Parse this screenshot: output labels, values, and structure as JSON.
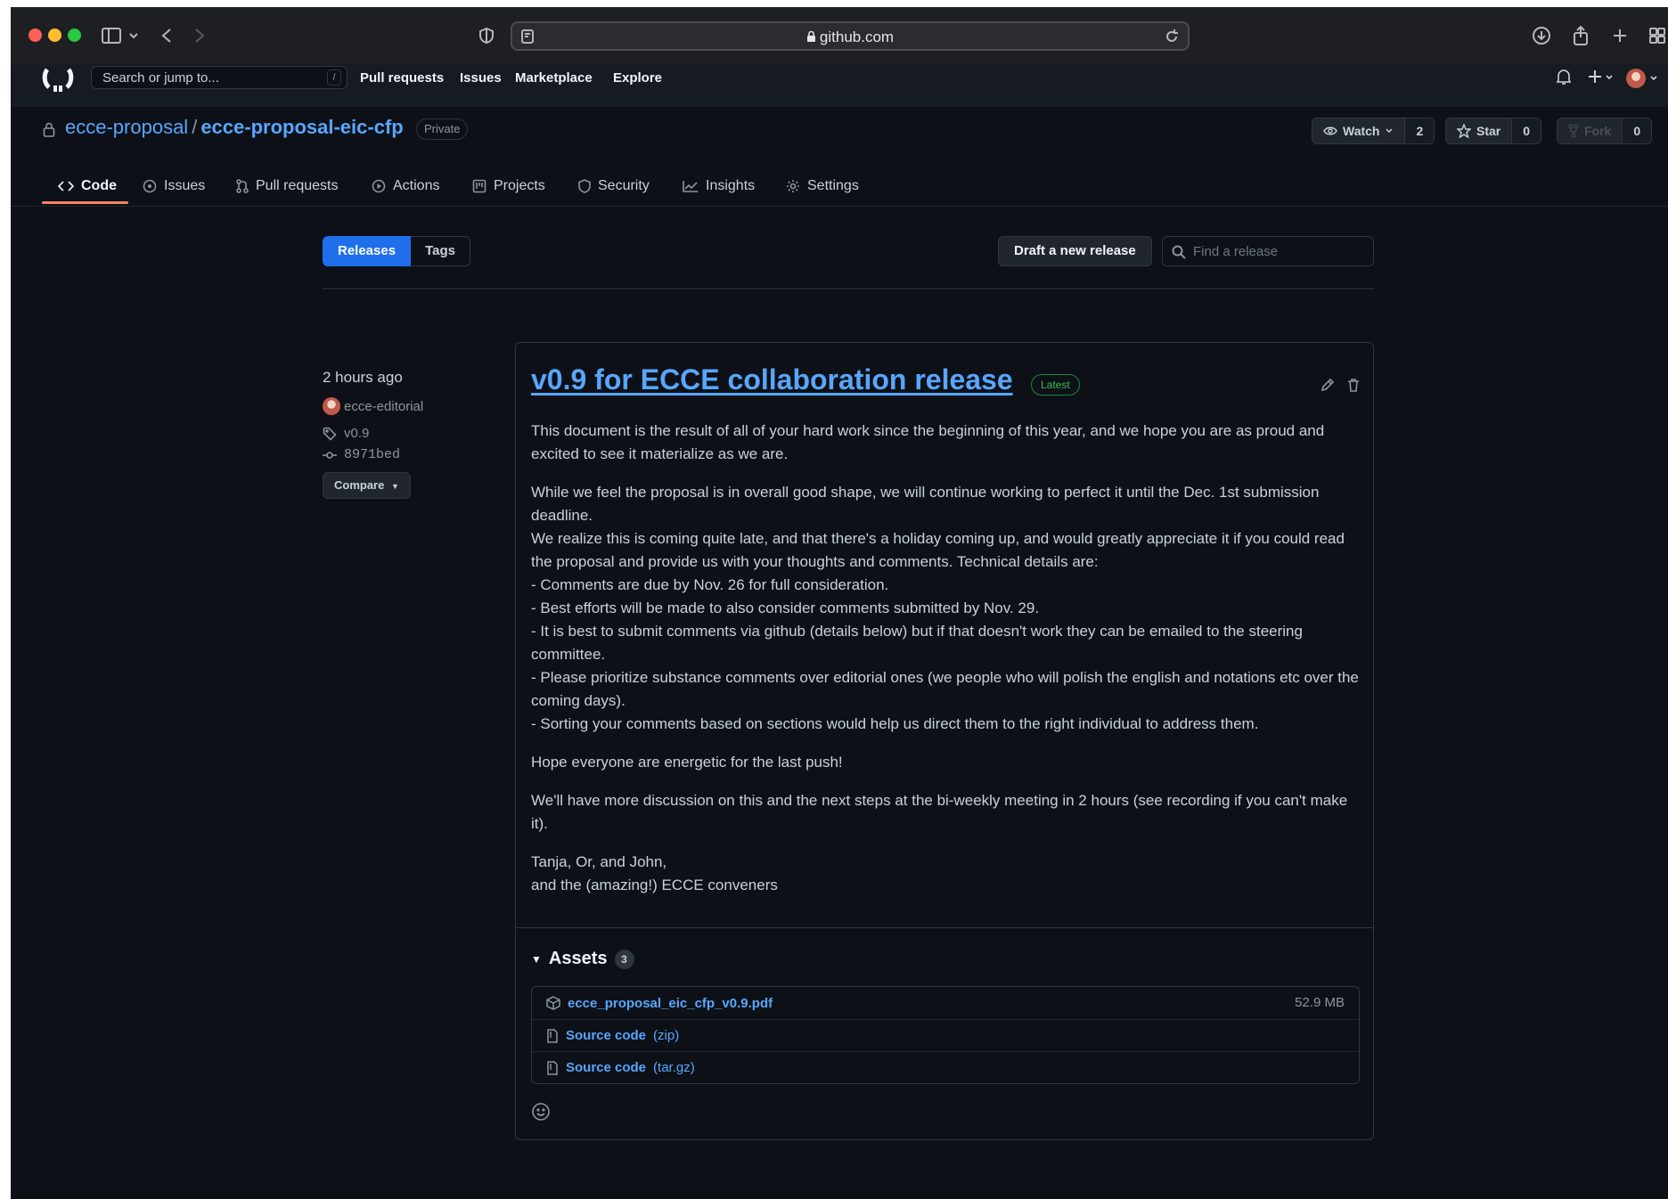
{
  "browser": {
    "url": "github.com",
    "colors": {
      "close": "#ff5f57",
      "minimize": "#febc2e",
      "maximize": "#28c840"
    }
  },
  "header": {
    "search_placeholder": "Search or jump to...",
    "search_shortcut": "/",
    "nav": [
      "Pull requests",
      "Issues",
      "Marketplace",
      "Explore"
    ]
  },
  "repo": {
    "owner": "ecce-proposal",
    "separator": "/",
    "name": "ecce-proposal-eic-cfp",
    "visibility": "Private",
    "watch_label": "Watch",
    "watch_count": "2",
    "star_label": "Star",
    "star_count": "0",
    "fork_label": "Fork",
    "fork_count": "0"
  },
  "tabs": {
    "code": "Code",
    "issues": "Issues",
    "pulls": "Pull requests",
    "actions": "Actions",
    "projects": "Projects",
    "security": "Security",
    "insights": "Insights",
    "settings": "Settings"
  },
  "subnav": {
    "releases": "Releases",
    "tags": "Tags",
    "draft_button": "Draft a new release",
    "find_placeholder": "Find a release"
  },
  "release": {
    "time": "2 hours ago",
    "author": "ecce-editorial",
    "tag": "v0.9",
    "commit": "8971bed",
    "compare_label": "Compare",
    "title": "v0.9 for ECCE collaboration release",
    "latest_badge": "Latest",
    "body": {
      "p1": "This document is the result of all of your hard work since the beginning of this year, and we hope you are as proud and excited to see it materialize as we are.",
      "p2_l1": "While we feel the proposal is in overall good shape, we will continue working to perfect it until the Dec. 1st submission deadline.",
      "p2_l2": "We realize this is coming quite late, and that there's a holiday coming up, and would greatly appreciate it if you could read the proposal and provide us with your thoughts and comments. Technical details are:",
      "p2_l3": "- Comments are due by Nov. 26 for full consideration.",
      "p2_l4": "- Best efforts will be made to also consider comments submitted by Nov. 29.",
      "p2_l5": "- It is best to submit comments via github (details below) but if that doesn't work they can be emailed to the steering committee.",
      "p2_l6": "- Please prioritize substance comments over editorial ones (we people who will polish the english and notations etc over the coming days).",
      "p2_l7": "- Sorting your comments based on sections would help us direct them to the right individual to address them.",
      "p3": "Hope everyone are energetic for the last push!",
      "p4": "We'll have more discussion on this and the next steps at the bi-weekly meeting in 2 hours (see recording if you can't make it).",
      "p5_l1": "Tanja, Or, and John,",
      "p5_l2": "and the (amazing!) ECCE conveners"
    },
    "assets": {
      "label": "Assets",
      "count": "3",
      "items": [
        {
          "name": "ecce_proposal_eic_cfp_v0.9.pdf",
          "suffix": "",
          "size": "52.9 MB",
          "icon": "package-icon"
        },
        {
          "name": "Source code",
          "suffix": "(zip)",
          "size": "",
          "icon": "file-zip-icon"
        },
        {
          "name": "Source code",
          "suffix": "(tar.gz)",
          "size": "",
          "icon": "file-zip-icon"
        }
      ]
    }
  },
  "colors": {
    "bg": "#0d1117",
    "link": "#58a6ff",
    "primary_button": "#1f6feb",
    "active_tab_underline": "#f78166",
    "latest_badge": "#3fb950"
  }
}
